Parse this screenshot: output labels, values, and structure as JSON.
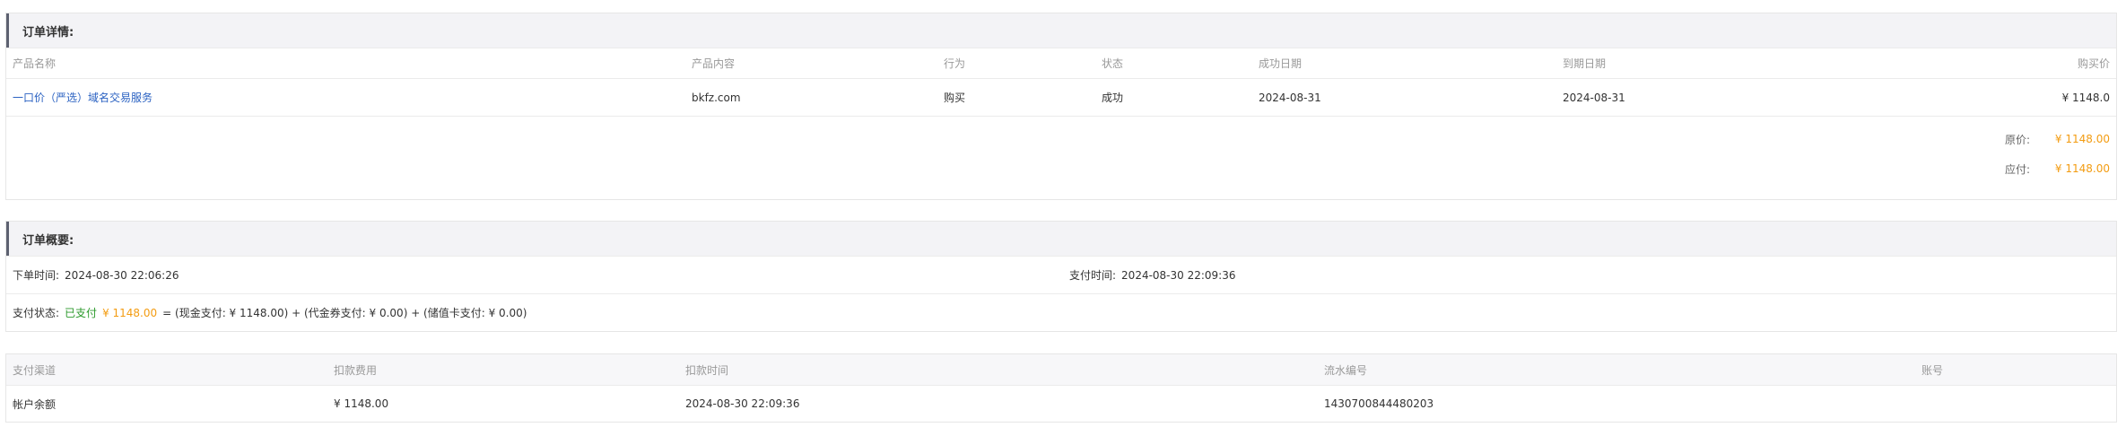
{
  "order_details": {
    "title": "订单详情:",
    "headers": {
      "product_name": "产品名称",
      "product_content": "产品内容",
      "action": "行为",
      "status": "状态",
      "success_date": "成功日期",
      "expire_date": "到期日期",
      "purchase_price": "购买价"
    },
    "row": {
      "product_name": "一口价（严选）域名交易服务",
      "product_content": "bkfz.com",
      "action": "购买",
      "status": "成功",
      "success_date": "2024-08-31",
      "expire_date": "2024-08-31",
      "purchase_price": "¥ 1148.0"
    },
    "original_label": "原价:",
    "original_value": "¥ 1148.00",
    "payable_label": "应付:",
    "payable_value": "¥ 1148.00"
  },
  "order_summary": {
    "title": "订单概要:",
    "order_time_label": "下单时间:",
    "order_time": "2024-08-30 22:06:26",
    "pay_time_label": "支付时间:",
    "pay_time": "2024-08-30 22:09:36",
    "pay_status_label": "支付状态:",
    "pay_status_value": "已支付",
    "pay_amount": "¥ 1148.00",
    "pay_breakdown": "= (现金支付: ¥ 1148.00) + (代金券支付: ¥ 0.00) + (储值卡支付: ¥ 0.00)"
  },
  "payment_table": {
    "headers": {
      "channel": "支付渠道",
      "amount": "扣款费用",
      "time": "扣款时间",
      "serial": "流水编号",
      "account": "账号"
    },
    "row": {
      "channel": "帐户余额",
      "amount": "¥ 1148.00",
      "time": "2024-08-30 22:09:36",
      "serial": "1430700844480203",
      "account": ""
    }
  },
  "colors": {
    "accent_orange": "#f39c12",
    "link_blue": "#2b62c2",
    "status_green": "#2c9a2c"
  }
}
